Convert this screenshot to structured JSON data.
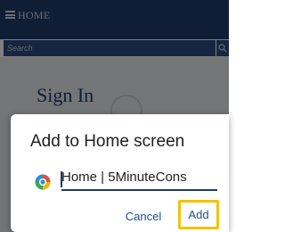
{
  "app_bar": {
    "menu_icon": "hamburger-menu-icon",
    "title": "HOME",
    "background_color": "#1f3a6b"
  },
  "search": {
    "placeholder": "Search",
    "button_icon": "search-icon"
  },
  "page": {
    "heading": "Sign In"
  },
  "dialog": {
    "title": "Add to Home screen",
    "site_icon": "globe-logo-icon",
    "name_value": "Home | 5MinuteCons",
    "cancel_label": "Cancel",
    "add_label": "Add",
    "accent_color": "#1f4e8c",
    "highlight_color": "#f3c20c"
  }
}
